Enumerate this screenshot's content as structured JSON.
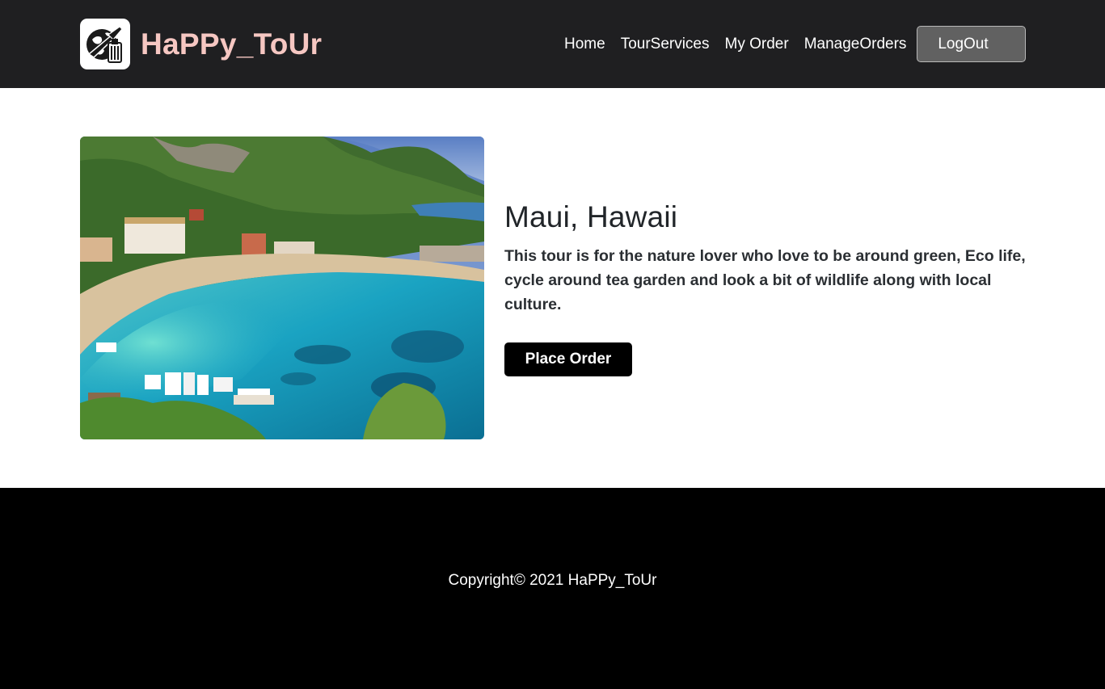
{
  "brand": {
    "name": "HaPPy_ToUr",
    "logo_icon": "travel-luggage-globe-icon"
  },
  "nav": {
    "links": [
      "Home",
      "TourServices",
      "My Order",
      "ManageOrders"
    ],
    "logout_label": "LogOut"
  },
  "tour": {
    "title": "Maui, Hawaii",
    "description": "This tour is for the nature lover who love to be around green, Eco life, cycle around tea garden and look a bit of wildlife along with local culture.",
    "image_icon": "beach-bay-photo",
    "order_label": "Place Order"
  },
  "footer": {
    "copyright": "Copyright© 2021 HaPPy_ToUr"
  },
  "colors": {
    "navbar_bg": "#1f1f21",
    "brand": "#f6c7c2",
    "logout_bg": "#616161",
    "footer_bg": "#000000",
    "order_button_bg": "#000000"
  }
}
